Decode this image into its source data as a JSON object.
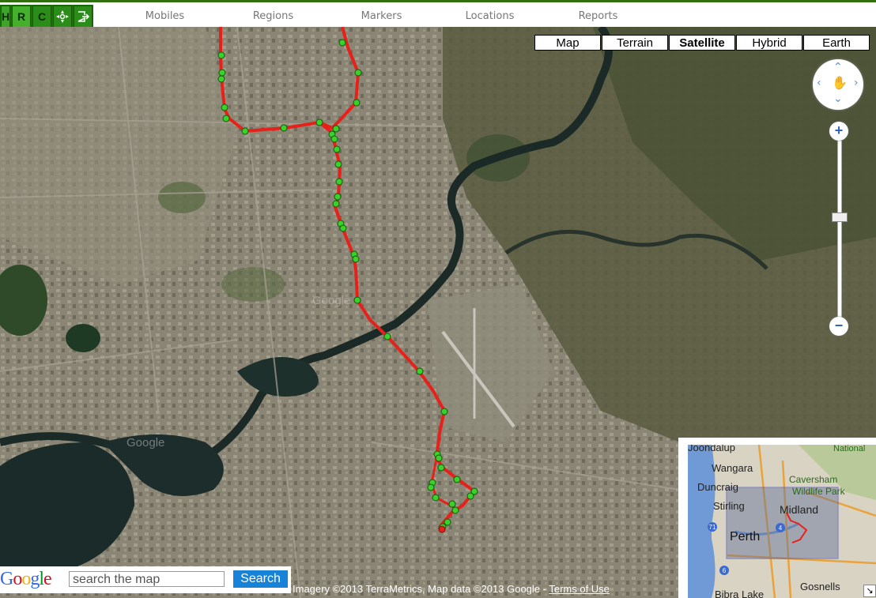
{
  "toolbar": {
    "buttons": [
      {
        "label": "H",
        "icon": "",
        "name": "tool-h-button"
      },
      {
        "label": "R",
        "icon": "",
        "name": "tool-r-button"
      },
      {
        "label": "C",
        "icon": "",
        "name": "tool-c-button"
      },
      {
        "label": "",
        "icon": "move-cross-icon",
        "name": "tool-move-button"
      },
      {
        "label": "",
        "icon": "exit-icon",
        "name": "tool-exit-button"
      }
    ]
  },
  "nav": [
    "Mobiles",
    "Regions",
    "Markers",
    "Locations",
    "Reports"
  ],
  "map_types": {
    "items": [
      "Map",
      "Terrain",
      "Satellite",
      "Hybrid",
      "Earth"
    ],
    "selected": "Satellite"
  },
  "zoom": {
    "in": "+",
    "out": "−"
  },
  "search": {
    "logo": "Google",
    "placeholder": "search the map",
    "button": "Search"
  },
  "attribution": {
    "text": "Imagery ©2013 TerraMetrics, Map data ©2013 Google - ",
    "link": "Terms of Use"
  },
  "overview": {
    "labels": [
      {
        "text": "Joondalup"
      },
      {
        "text": "Wangara"
      },
      {
        "text": "Duncraig"
      },
      {
        "text": "Stirling"
      },
      {
        "text": "Perth"
      },
      {
        "text": "Midland"
      },
      {
        "text": "Caversham"
      },
      {
        "text": "Wildlife Park"
      },
      {
        "text": "Gosnells"
      },
      {
        "text": "Bibra Lake"
      },
      {
        "text": "National"
      }
    ],
    "shields": [
      "71",
      "4",
      "6"
    ]
  },
  "map_labels": [
    "Google",
    "Google"
  ],
  "colors": {
    "route": "#e8201a",
    "waypoint": "#3ad12a",
    "toolbar": "#1f6f0b",
    "search_button": "#1683d8"
  }
}
